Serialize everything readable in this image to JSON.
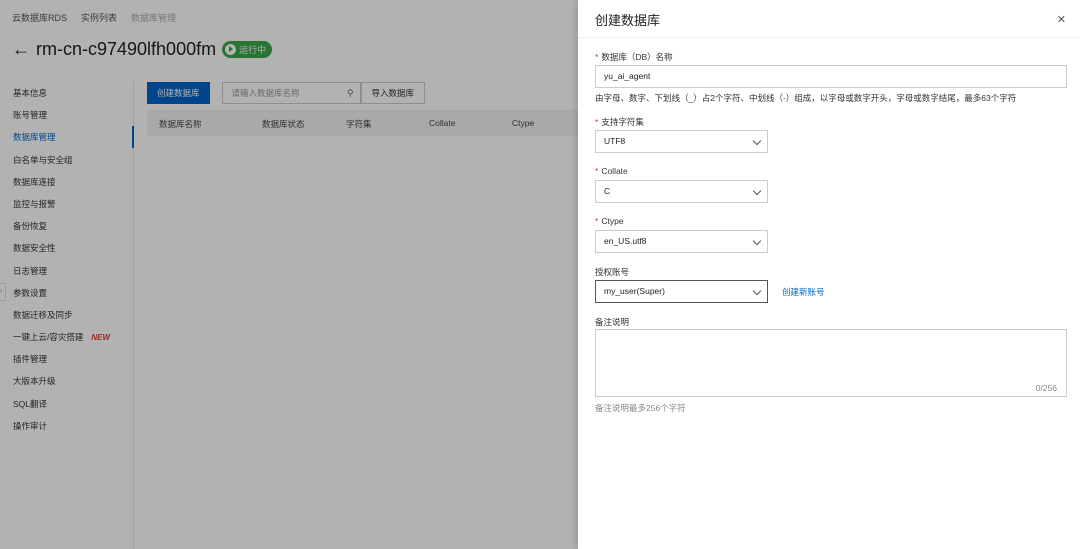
{
  "breadcrumb": [
    "云数据库RDS",
    "实例列表",
    "数据库管理"
  ],
  "instance": {
    "id": "rm-cn-c97490lfh000fm",
    "status": "运行中"
  },
  "sidebar": {
    "items": [
      {
        "label": "基本信息"
      },
      {
        "label": "账号管理"
      },
      {
        "label": "数据库管理"
      },
      {
        "label": "白名单与安全组"
      },
      {
        "label": "数据库连接"
      },
      {
        "label": "监控与报警"
      },
      {
        "label": "备份恢复"
      },
      {
        "label": "数据安全性"
      },
      {
        "label": "日志管理"
      },
      {
        "label": "参数设置"
      },
      {
        "label": "数据迁移及同步"
      },
      {
        "label": "一键上云/容灾搭建",
        "badge": "NEW"
      },
      {
        "label": "插件管理"
      },
      {
        "label": "大版本升级"
      },
      {
        "label": "SQL翻译"
      },
      {
        "label": "操作审计"
      }
    ]
  },
  "toolbar": {
    "create_label": "创建数据库",
    "search_placeholder": "请输入数据库名称",
    "import_label": "导入数据库"
  },
  "table": {
    "columns": [
      "数据库名称",
      "数据库状态",
      "字符集",
      "Collate",
      "Ctype"
    ]
  },
  "drawer": {
    "title": "创建数据库",
    "db_name_label": "数据库（DB）名称",
    "db_name_value": "yu_ai_agent",
    "db_name_help": "由字母、数字、下划线（_）占2个字符、中划线（-）组成，以字母或数字开头，字母或数字结尾，最多63个字符",
    "charset_label": "支持字符集",
    "charset_value": "UTF8",
    "collate_label": "Collate",
    "collate_value": "C",
    "ctype_label": "Ctype",
    "ctype_value": "en_US.utf8",
    "account_label": "授权账号",
    "account_value": "my_user(Super)",
    "create_account_link": "创建新账号",
    "remark_label": "备注说明",
    "remark_counter": "0/256",
    "remark_help": "备注说明最多256个字符"
  }
}
